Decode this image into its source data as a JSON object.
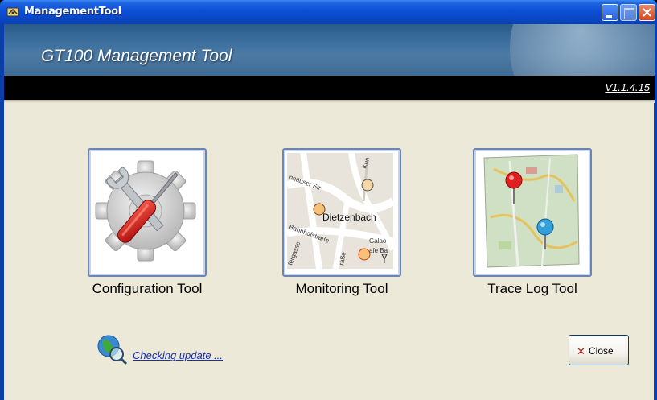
{
  "window": {
    "title": "ManagementTool",
    "controls": [
      "minimize",
      "maximize",
      "close"
    ]
  },
  "header": {
    "title": "GT100 Management Tool",
    "version": "V1.1.4.15"
  },
  "tools": [
    {
      "label": "Configuration Tool",
      "icon": "wrench-gear-icon"
    },
    {
      "label": "Monitoring Tool",
      "icon": "street-map-icon",
      "map_labels": [
        "Dietzenbach",
        "Galao",
        "afe Ba",
        "Kun",
        "Bahnhofstraße",
        "nhäuser Str",
        "fergasse",
        "raße"
      ]
    },
    {
      "label": "Trace Log Tool",
      "icon": "trace-map-pins-icon"
    }
  ],
  "footer": {
    "update_text": "Checking update ...",
    "close_label": "Close"
  },
  "colors": {
    "titlebar": "#0b4fd6",
    "client": "#ece9d8",
    "banner": "#3c6f9f",
    "link": "#1a2fb0"
  }
}
